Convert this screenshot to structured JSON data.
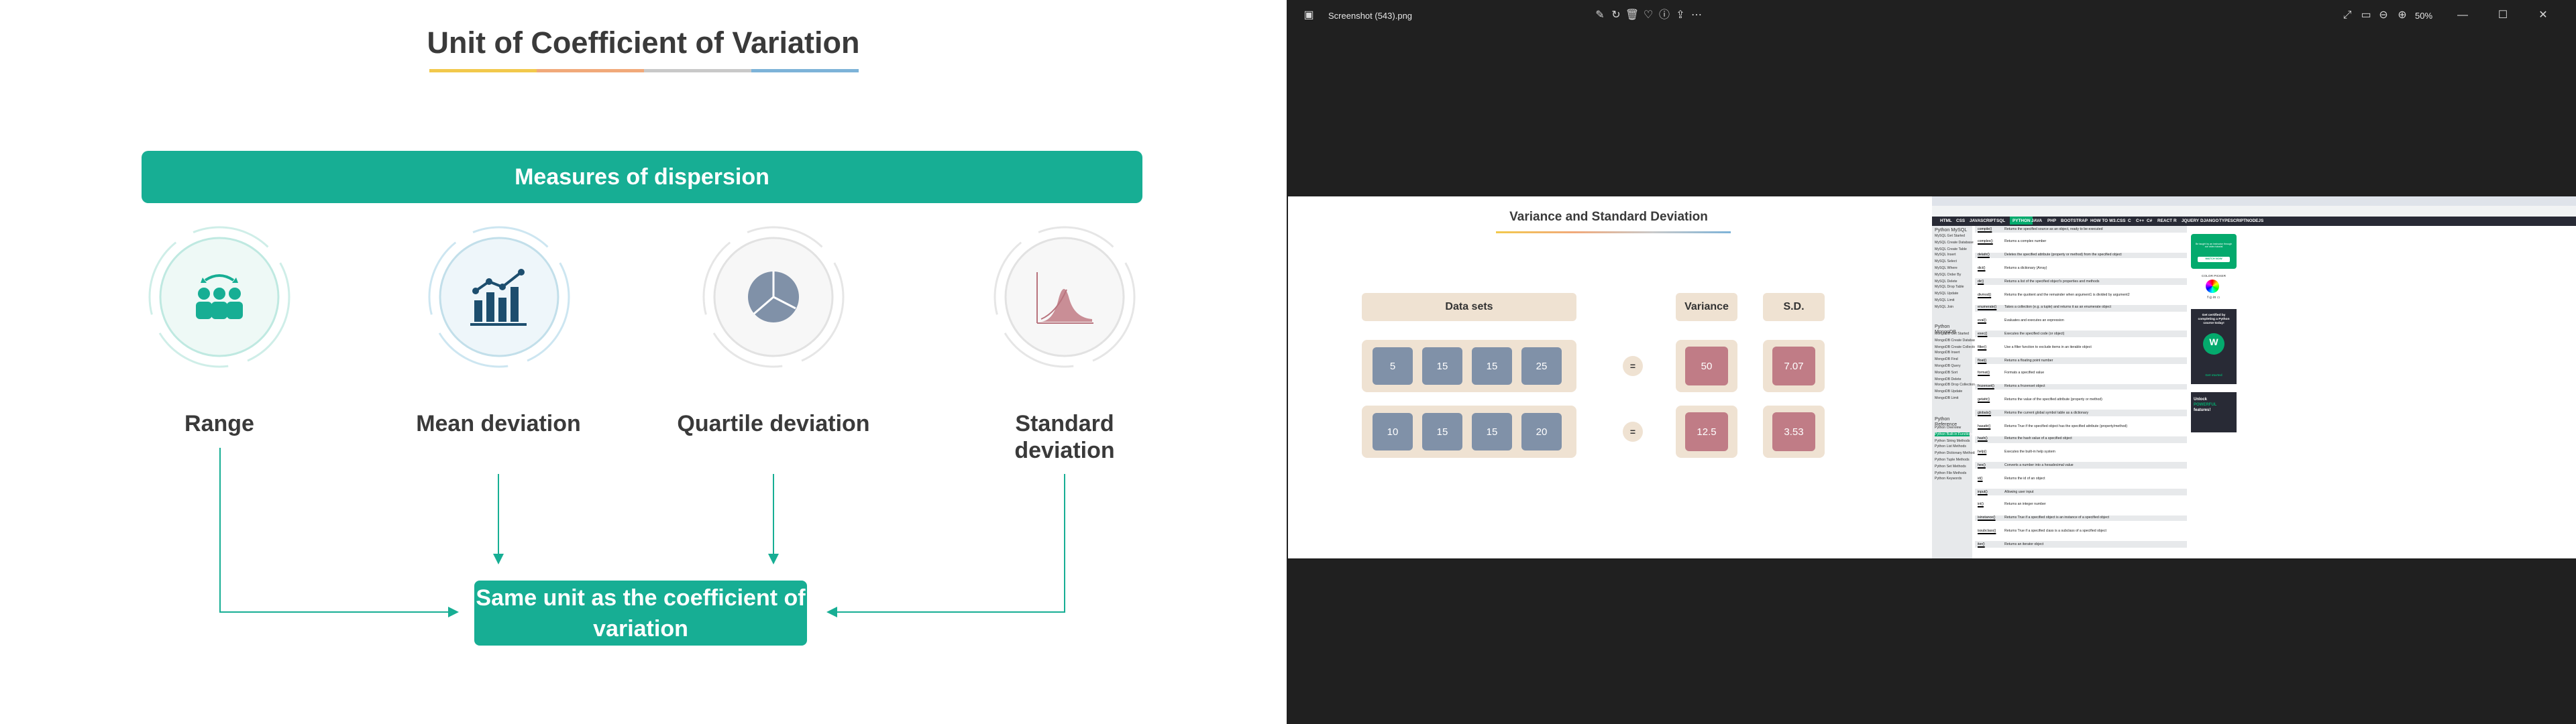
{
  "slide": {
    "title": "Unit of Coefficient of Variation",
    "measures_header": "Measures of dispersion",
    "measures": [
      {
        "label": "Range",
        "icon": "people-exchange-icon"
      },
      {
        "label": "Mean deviation",
        "icon": "bar-chart-trend-icon"
      },
      {
        "label": "Quartile deviation",
        "icon": "pie-chart-icon"
      },
      {
        "label": "Standard deviation",
        "icon": "distribution-curve-icon"
      }
    ],
    "result": "Same unit as the coefficient of variation",
    "accent": "#17ae94"
  },
  "viewer": {
    "filename": "Screenshot (543).png",
    "zoom": "50%",
    "embedded_slide": {
      "title": "Variance and Standard Deviation",
      "headers": {
        "data_sets": "Data sets",
        "variance": "Variance",
        "sd": "S.D."
      },
      "rows": [
        {
          "values": [
            "5",
            "15",
            "15",
            "25"
          ],
          "eq": "=",
          "variance": "50",
          "sd": "7.07"
        },
        {
          "values": [
            "10",
            "15",
            "15",
            "20"
          ],
          "eq": "=",
          "variance": "12.5",
          "sd": "3.53"
        }
      ]
    },
    "browser": {
      "nav": [
        "HTML",
        "CSS",
        "JAVASCRIPT",
        "SQL",
        "PYTHON",
        "JAVA",
        "PHP",
        "BOOTSTRAP",
        "HOW TO",
        "W3.CSS",
        "C",
        "C++",
        "C#",
        "REACT",
        "R",
        "JQUERY",
        "DJANGO",
        "TYPESCRIPT",
        "NODEJS"
      ],
      "sidebar": {
        "head1": "Python MySQL",
        "items1": [
          "MySQL Get Started",
          "MySQL Create Database",
          "MySQL Create Table",
          "MySQL Insert",
          "MySQL Select",
          "MySQL Where",
          "MySQL Order By",
          "MySQL Delete",
          "MySQL Drop Table",
          "MySQL Update",
          "MySQL Limit",
          "MySQL Join"
        ],
        "head2": "Python MongoDB",
        "items2": [
          "MongoDB Get Started",
          "MongoDB Create Database",
          "MongoDB Create Collection",
          "MongoDB Insert",
          "MongoDB Find",
          "MongoDB Query",
          "MongoDB Sort",
          "MongoDB Delete",
          "MongoDB Drop Collection",
          "MongoDB Update",
          "MongoDB Limit"
        ],
        "head3": "Python Reference",
        "items3": [
          "Python Overview",
          "Python Built-in Functions",
          "Python String Methods",
          "Python List Methods",
          "Python Dictionary Methods",
          "Python Tuple Methods",
          "Python Set Methods",
          "Python File Methods",
          "Python Keywords"
        ]
      },
      "reference": [
        {
          "fn": "compile()",
          "desc": "Returns the specified source as an object, ready to be executed"
        },
        {
          "fn": "complex()",
          "desc": "Returns a complex number"
        },
        {
          "fn": "delattr()",
          "desc": "Deletes the specified attribute (property or method) from the specified object"
        },
        {
          "fn": "dict()",
          "desc": "Returns a dictionary (Array)"
        },
        {
          "fn": "dir()",
          "desc": "Returns a list of the specified object's properties and methods"
        },
        {
          "fn": "divmod()",
          "desc": "Returns the quotient and the remainder when argument1 is divided by argument2"
        },
        {
          "fn": "enumerate()",
          "desc": "Takes a collection (e.g. a tuple) and returns it as an enumerate object"
        },
        {
          "fn": "eval()",
          "desc": "Evaluates and executes an expression"
        },
        {
          "fn": "exec()",
          "desc": "Executes the specified code (or object)"
        },
        {
          "fn": "filter()",
          "desc": "Use a filter function to exclude items in an iterable object"
        },
        {
          "fn": "float()",
          "desc": "Returns a floating point number"
        },
        {
          "fn": "format()",
          "desc": "Formats a specified value"
        },
        {
          "fn": "frozenset()",
          "desc": "Returns a frozenset object"
        },
        {
          "fn": "getattr()",
          "desc": "Returns the value of the specified attribute (property or method)"
        },
        {
          "fn": "globals()",
          "desc": "Returns the current global symbol table as a dictionary"
        },
        {
          "fn": "hasattr()",
          "desc": "Returns True if the specified object has the specified attribute (property/method)"
        },
        {
          "fn": "hash()",
          "desc": "Returns the hash value of a specified object"
        },
        {
          "fn": "help()",
          "desc": "Executes the built-in help system"
        },
        {
          "fn": "hex()",
          "desc": "Converts a number into a hexadecimal value"
        },
        {
          "fn": "id()",
          "desc": "Returns the id of an object"
        },
        {
          "fn": "input()",
          "desc": "Allowing user input"
        },
        {
          "fn": "int()",
          "desc": "Returns an integer number"
        },
        {
          "fn": "isinstance()",
          "desc": "Returns True if a specified object is an instance of a specified object"
        },
        {
          "fn": "issubclass()",
          "desc": "Returns True if a specified class is a subclass of a specified object"
        },
        {
          "fn": "iter()",
          "desc": "Returns an iterator object"
        }
      ],
      "ads": {
        "video_text": "Be taught by an instructor through our video tutorial",
        "watch": "WATCH NOW",
        "color_picker": "COLOR PICKER",
        "cert_text": "Get certified by completing a Python course today!",
        "get_started": "Get started",
        "unlock": "Unlock",
        "powerful": "POWERFUL",
        "features": "features!"
      }
    }
  }
}
